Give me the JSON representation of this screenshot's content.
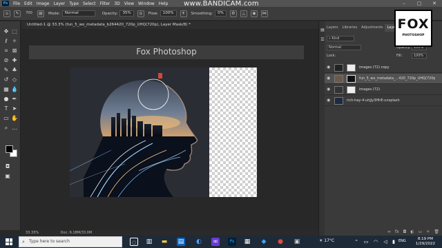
{
  "app": {
    "menu": [
      "File",
      "Edit",
      "Image",
      "Layer",
      "Type",
      "Select",
      "Filter",
      "3D",
      "View",
      "Window",
      "Help"
    ],
    "watermark": "www.BANDICAM.com",
    "window_controls": [
      "–",
      "▢",
      "✕"
    ]
  },
  "options": {
    "mode_label": "Mode:",
    "mode_value": "Normal",
    "opacity_label": "Opacity:",
    "opacity_value": "35%",
    "flow_label": "Flow:",
    "flow_value": "100%",
    "smoothing_label": "Smoothing:",
    "smoothing_value": "0%",
    "brush_size": "700"
  },
  "document": {
    "tab_title": "Untitled-1 @ 33.3% (fun_5_wo_metadata_b264420_720p_UHQ(720p), Layer Mask/8) *",
    "close": "✕",
    "banner": "Fox Photoshop",
    "zoom": "33.33%",
    "doc_size": "Doc: 6.18M/33.0M"
  },
  "layers_panel": {
    "tabs": [
      "Layers",
      "Libraries",
      "Adjustments",
      "Layers"
    ],
    "active_tab": 3,
    "kind_label": "Kind",
    "blend": "Normal",
    "opacity_label": "Opacity:",
    "opacity": "100%",
    "lock_label": "Lock:",
    "fill_label": "Fill:",
    "fill": "100%",
    "layers": [
      {
        "name": "images (72) copy",
        "selected": false,
        "mask": true
      },
      {
        "name": "fun_5_wo_metadata_...420_720p_UHQ(720p)",
        "selected": true,
        "mask": true
      },
      {
        "name": "images (72)",
        "selected": false,
        "mask": true
      },
      {
        "name": "rich-hay-4-uhjJy3HhE-unsplash",
        "selected": false,
        "mask": false
      }
    ],
    "bottom_icons": [
      "∞",
      "fx",
      "◘",
      "◐",
      "▭",
      "+",
      "🗑"
    ]
  },
  "fox_logo": {
    "title": "FOX",
    "subtitle": "PHOTOSHOP"
  },
  "taskbar": {
    "search_placeholder": "Type here to search",
    "temperature": "17°C",
    "lang": "ENG",
    "time": "8:19 PM",
    "date": "1/29/2022"
  },
  "colors": {
    "accent": "#31a8ff",
    "taskbar": "#1f2a38",
    "panel": "#3a3a3a"
  }
}
